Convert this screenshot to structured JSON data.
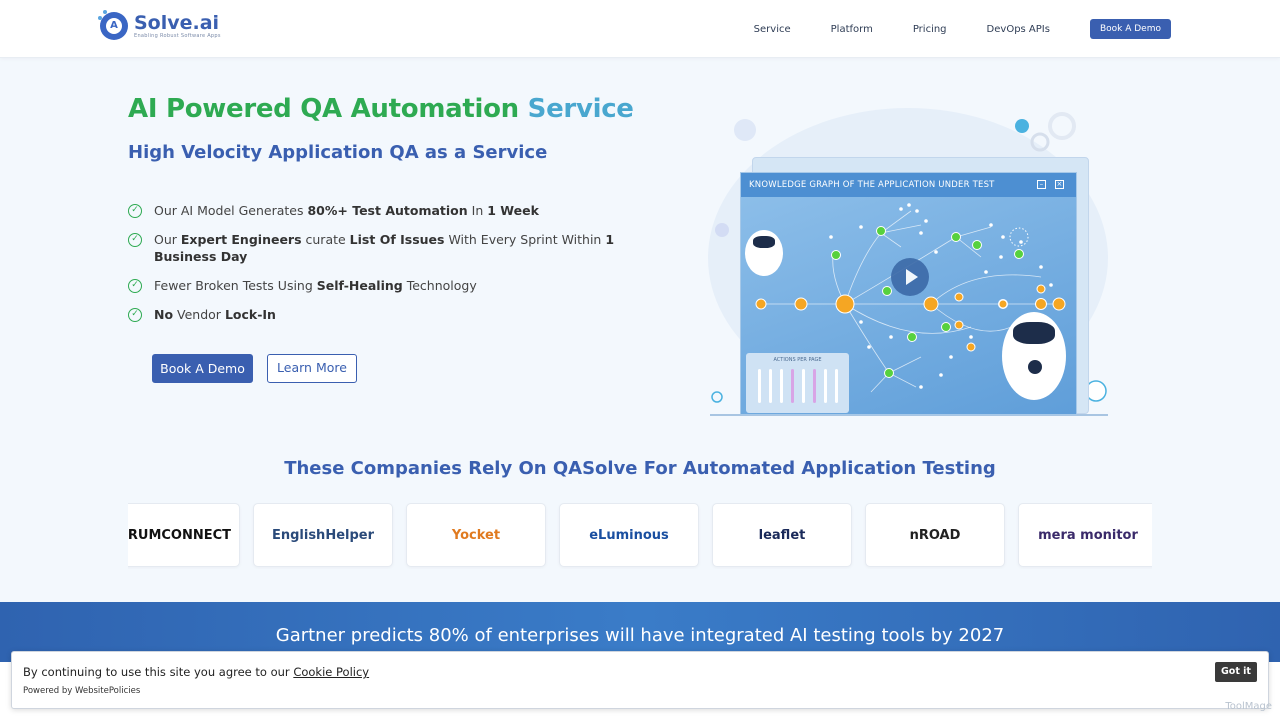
{
  "header": {
    "logo_name": "Solve.ai",
    "logo_tag": "Enabling Robust Software Apps",
    "nav": [
      "Service",
      "Platform",
      "Pricing",
      "DevOps APIs"
    ],
    "demo_label": "Book A Demo"
  },
  "hero": {
    "title_green": "AI Powered QA Automation",
    "title_blue": "Service",
    "subtitle": "High Velocity Application QA as a Service",
    "bullets": [
      [
        {
          "t": "Our AI Model Generates "
        },
        {
          "t": "80%+ Test Automation",
          "b": true
        },
        {
          "t": " In "
        },
        {
          "t": "1 Week",
          "b": true
        }
      ],
      [
        {
          "t": "Our "
        },
        {
          "t": "Expert Engineers",
          "b": true
        },
        {
          "t": " curate "
        },
        {
          "t": "List Of Issues",
          "b": true
        },
        {
          "t": " With Every Sprint Within "
        },
        {
          "t": "1 Business Day",
          "b": true
        }
      ],
      [
        {
          "t": "Fewer Broken Tests Using "
        },
        {
          "t": "Self-Healing",
          "b": true
        },
        {
          "t": " Technology"
        }
      ],
      [
        {
          "t": "No",
          "b": true
        },
        {
          "t": " Vendor "
        },
        {
          "t": "Lock-In",
          "b": true
        }
      ]
    ],
    "primary_button": "Book A Demo",
    "secondary_button": "Learn More"
  },
  "illustration": {
    "panel_title": "KNOWLEDGE GRAPH OF THE APPLICATION UNDER TEST",
    "actions_label": "ACTIONS PER PAGE"
  },
  "companies": {
    "title": "These Companies Rely On QASolve For Automated Application Testing",
    "logos": [
      {
        "name": "SCRUMCONNECT",
        "color": "#111111"
      },
      {
        "name": "EnglishHelper",
        "color": "#2a4a7a"
      },
      {
        "name": "Yocket",
        "color": "#e07a1f"
      },
      {
        "name": "eLuminous",
        "color": "#1a4fa0"
      },
      {
        "name": "leaflet",
        "color": "#1a2a5a"
      },
      {
        "name": "nROAD",
        "color": "#222222"
      },
      {
        "name": "mera monitor",
        "color": "#3a2a6a"
      }
    ]
  },
  "gartner": {
    "text": "Gartner predicts 80% of enterprises will have integrated AI testing tools by 2027"
  },
  "cookie": {
    "message": "By continuing to use this site you agree to our ",
    "link": "Cookie Policy",
    "powered": "Powered by WebsitePolicies",
    "button": "Got it"
  },
  "watermark": "ToolMage",
  "colors": {
    "primary": "#3a5fb0",
    "green": "#2eaa52",
    "light_blue": "#49a7cf",
    "background": "#f3f8fd"
  }
}
